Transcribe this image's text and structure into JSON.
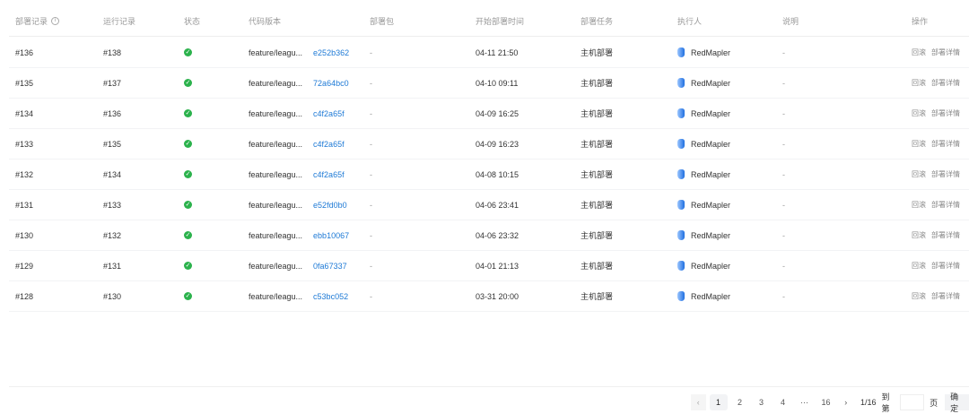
{
  "columns": [
    "部署记录",
    "运行记录",
    "状态",
    "代码版本",
    "部署包",
    "开始部署时间",
    "部署任务",
    "执行人",
    "说明",
    "操作"
  ],
  "rows": [
    {
      "deploy": "#136",
      "run": "#138",
      "status": "success",
      "branch": "feature/leagu...",
      "commit": "e252b362",
      "pkg": "-",
      "time": "04-11 21:50",
      "task": "主机部署",
      "user": "RedMapler",
      "note": "-"
    },
    {
      "deploy": "#135",
      "run": "#137",
      "status": "success",
      "branch": "feature/leagu...",
      "commit": "72a64bc0",
      "pkg": "-",
      "time": "04-10 09:11",
      "task": "主机部署",
      "user": "RedMapler",
      "note": "-"
    },
    {
      "deploy": "#134",
      "run": "#136",
      "status": "success",
      "branch": "feature/leagu...",
      "commit": "c4f2a65f",
      "pkg": "-",
      "time": "04-09 16:25",
      "task": "主机部署",
      "user": "RedMapler",
      "note": "-"
    },
    {
      "deploy": "#133",
      "run": "#135",
      "status": "success",
      "branch": "feature/leagu...",
      "commit": "c4f2a65f",
      "pkg": "-",
      "time": "04-09 16:23",
      "task": "主机部署",
      "user": "RedMapler",
      "note": "-"
    },
    {
      "deploy": "#132",
      "run": "#134",
      "status": "success",
      "branch": "feature/leagu...",
      "commit": "c4f2a65f",
      "pkg": "-",
      "time": "04-08 10:15",
      "task": "主机部署",
      "user": "RedMapler",
      "note": "-"
    },
    {
      "deploy": "#131",
      "run": "#133",
      "status": "success",
      "branch": "feature/leagu...",
      "commit": "e52fd0b0",
      "pkg": "-",
      "time": "04-06 23:41",
      "task": "主机部署",
      "user": "RedMapler",
      "note": "-"
    },
    {
      "deploy": "#130",
      "run": "#132",
      "status": "success",
      "branch": "feature/leagu...",
      "commit": "ebb10067",
      "pkg": "-",
      "time": "04-06 23:32",
      "task": "主机部署",
      "user": "RedMapler",
      "note": "-"
    },
    {
      "deploy": "#129",
      "run": "#131",
      "status": "success",
      "branch": "feature/leagu...",
      "commit": "0fa67337",
      "pkg": "-",
      "time": "04-01 21:13",
      "task": "主机部署",
      "user": "RedMapler",
      "note": "-"
    },
    {
      "deploy": "#128",
      "run": "#130",
      "status": "success",
      "branch": "feature/leagu...",
      "commit": "c53bc052",
      "pkg": "-",
      "time": "03-31 20:00",
      "task": "主机部署",
      "user": "RedMapler",
      "note": "-"
    }
  ],
  "actions": {
    "rollback": "回滚",
    "details": "部署详情"
  },
  "pagination": {
    "pages": [
      "1",
      "2",
      "3",
      "4",
      "···",
      "16"
    ],
    "current": "1",
    "summary": "1/16",
    "goto_label": "到第",
    "page_label": "页",
    "confirm": "确定"
  }
}
